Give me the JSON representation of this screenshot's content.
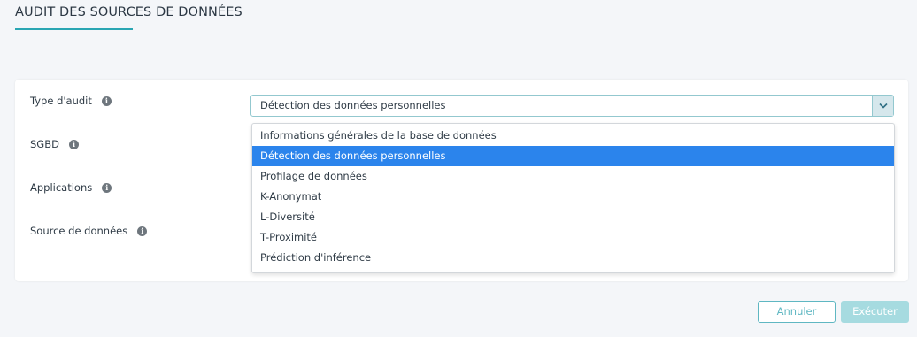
{
  "page": {
    "title": "AUDIT DES SOURCES DE DONNÉES"
  },
  "form": {
    "fields": [
      {
        "label": "Type d'audit",
        "icon": "info-icon"
      },
      {
        "label": "SGBD",
        "icon": "info-icon"
      },
      {
        "label": "Applications",
        "icon": "info-icon"
      },
      {
        "label": "Source de données",
        "icon": "info-icon"
      }
    ],
    "audit_type": {
      "value": "Détection des données personnelles",
      "options": [
        "Informations générales de la base de données",
        "Détection des données personnelles",
        "Profilage de données",
        "K-Anonymat",
        "L-Diversité",
        "T-Proximité",
        "Prédiction d'inférence"
      ],
      "selected_index": 1
    }
  },
  "actions": {
    "cancel_label": "Annuler",
    "run_label": "Exécuter"
  },
  "colors": {
    "accent": "#2aa6b3",
    "highlight": "#2b84ec",
    "disabled_button": "#a6dbe0"
  }
}
